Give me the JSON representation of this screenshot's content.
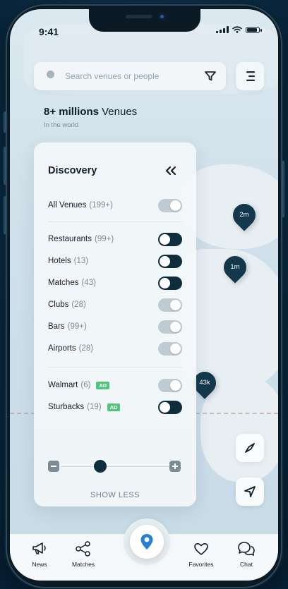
{
  "status_bar": {
    "time": "9:41"
  },
  "search": {
    "placeholder": "Search venues or people"
  },
  "stats": {
    "title_strong": "8+ millions",
    "title_rest": "Venues",
    "subtitle": "In the world"
  },
  "panel": {
    "title": "Discovery",
    "all": {
      "label": "All Venues",
      "count": "(199+)",
      "on": false
    },
    "group1": [
      {
        "label": "Restaurants",
        "count": "(99+)",
        "on": true
      },
      {
        "label": "Hotels",
        "count": "(13)",
        "on": true
      },
      {
        "label": "Matches",
        "count": "(43)",
        "on": true
      },
      {
        "label": "Clubs",
        "count": "(28)",
        "on": false
      },
      {
        "label": "Bars",
        "count": "(99+)",
        "on": false
      },
      {
        "label": "Airports",
        "count": "(28)",
        "on": false
      }
    ],
    "ads": [
      {
        "label": "Walmart",
        "count": "(6)",
        "badge": "AD",
        "on": false
      },
      {
        "label": "Sturbacks",
        "count": "(19)",
        "badge": "AD",
        "on": true
      }
    ],
    "slider_level": 0.35,
    "show_less_label": "SHOW LESS"
  },
  "pins": [
    {
      "label": "2m"
    },
    {
      "label": "1m"
    },
    {
      "label": "43k"
    }
  ],
  "nav": {
    "items": [
      {
        "label": "News",
        "icon": "megaphone-icon"
      },
      {
        "label": "Matches",
        "icon": "share-nodes-icon"
      },
      {
        "label": "Favorites",
        "icon": "heart-icon"
      },
      {
        "label": "Chat",
        "icon": "chat-bubbles-icon"
      }
    ],
    "center_icon": "location-pin-icon"
  },
  "colors": {
    "dark": "#0f2e3d",
    "ad_badge": "#53c37c",
    "map": "#c7dbe6"
  }
}
